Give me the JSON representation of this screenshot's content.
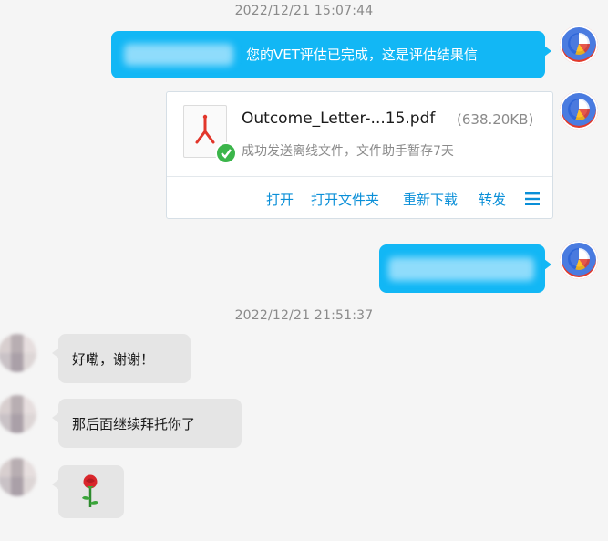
{
  "timestamps": [
    "2022/12/21 15:07:44",
    "2022/12/21 21:51:37"
  ],
  "messages": {
    "result_text": "您的VET评估已完成，这是评估结果信",
    "reply1": "好嘞，谢谢！",
    "reply2": "那后面继续拜托你了",
    "reply3_icon": "rose-icon"
  },
  "file": {
    "name": "Outcome_Letter-...15.pdf",
    "size": "(638.20KB)",
    "status": "成功发送离线文件，文件助手暂存7天",
    "icon": "pdf-icon",
    "status_icon": "check-icon",
    "actions": {
      "open": "打开",
      "open_folder": "打开文件夹",
      "redownload": "重新下载",
      "forward": "转发",
      "more_icon": "menu-icon"
    }
  },
  "colors": {
    "accent": "#12b7f5",
    "link": "#0a8fd8",
    "pdf": "#e2362b",
    "check": "#3bb54a",
    "bubble_gray": "#e5e5e5"
  }
}
